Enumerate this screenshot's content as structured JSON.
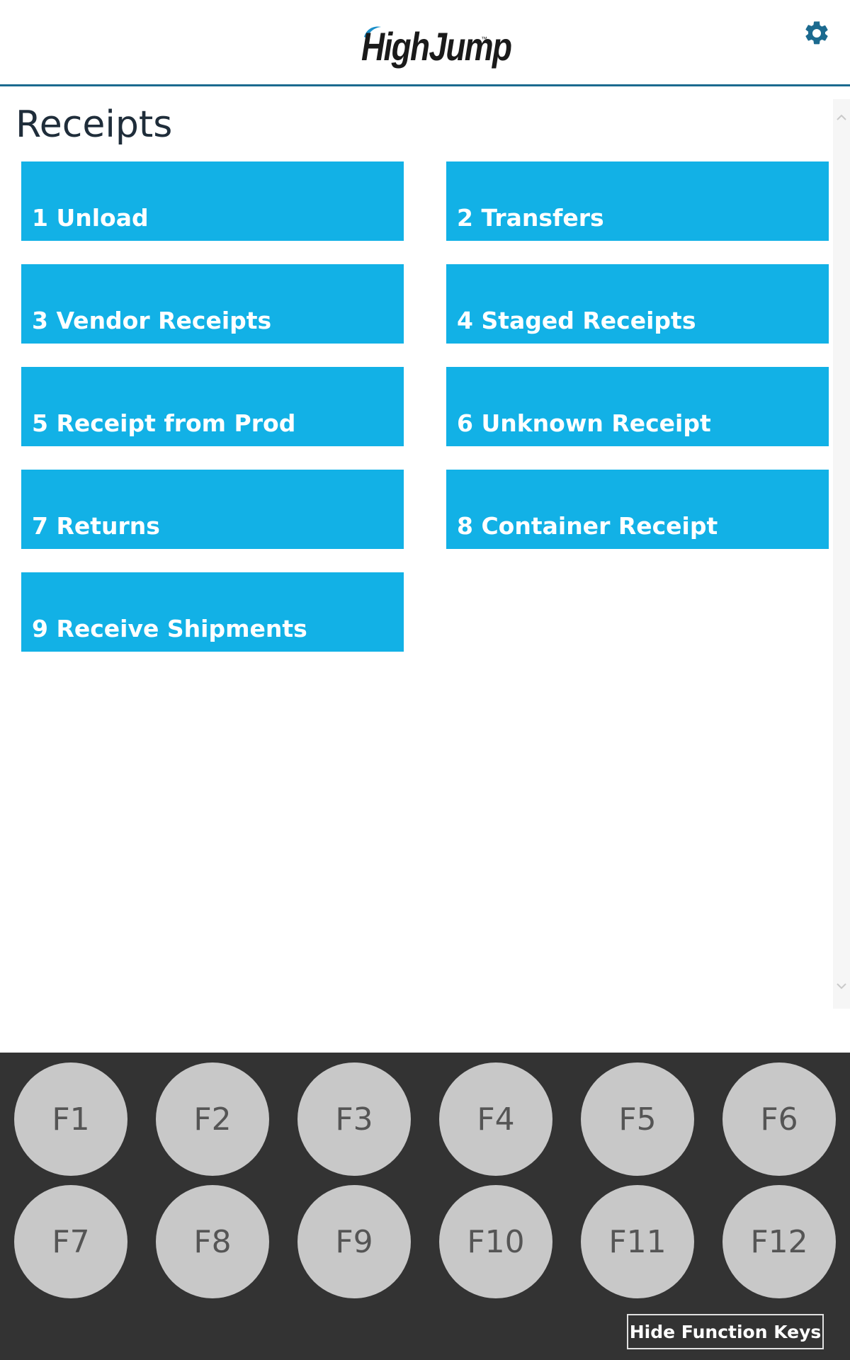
{
  "header": {
    "logo_text": "HighJump",
    "logo_tm": "™",
    "settings_icon": "gear-icon",
    "accent_color": "#1b6a8f"
  },
  "page": {
    "title": "Receipts"
  },
  "menu": {
    "button_color": "#12b1e6",
    "items": [
      {
        "label": "1 Unload"
      },
      {
        "label": "2 Transfers"
      },
      {
        "label": "3 Vendor Receipts"
      },
      {
        "label": "4 Staged Receipts"
      },
      {
        "label": "5 Receipt from Prod"
      },
      {
        "label": "6 Unknown Receipt"
      },
      {
        "label": "7 Returns"
      },
      {
        "label": "8 Container Receipt"
      },
      {
        "label": "9 Receive Shipments"
      }
    ]
  },
  "function_keys": {
    "keys": [
      "F1",
      "F2",
      "F3",
      "F4",
      "F5",
      "F6",
      "F7",
      "F8",
      "F9",
      "F10",
      "F11",
      "F12"
    ],
    "hide_label": "Hide Function Keys",
    "panel_color": "#333333",
    "key_color": "#c8c8c8"
  },
  "scrollbar": {
    "up_icon": "chevron-up-icon",
    "down_icon": "chevron-down-icon"
  }
}
